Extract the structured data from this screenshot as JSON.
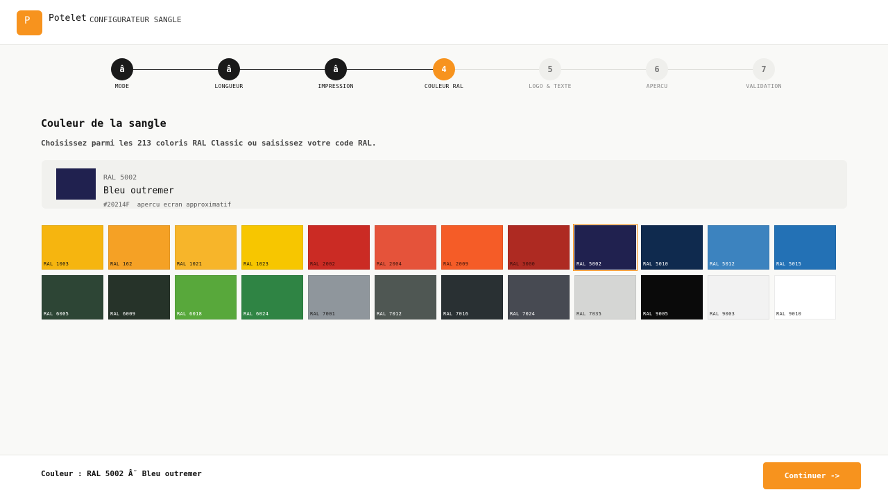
{
  "header": {
    "logo_letter": "P",
    "brand": "Potelet",
    "subtitle": "CONFIGURATEUR SANGLE"
  },
  "colors": {
    "accent": "#f7931e",
    "done": "#1a1a1a"
  },
  "stepper": {
    "steps": [
      {
        "marker": "â",
        "label": "MODE",
        "state": "done"
      },
      {
        "marker": "â",
        "label": "LONGUEUR",
        "state": "done"
      },
      {
        "marker": "â",
        "label": "IMPRESSION",
        "state": "done"
      },
      {
        "marker": "4",
        "label": "COULEUR RAL",
        "state": "active"
      },
      {
        "marker": "5",
        "label": "LOGO & TEXTE",
        "state": "todo"
      },
      {
        "marker": "6",
        "label": "APERCU",
        "state": "todo"
      },
      {
        "marker": "7",
        "label": "VALIDATION",
        "state": "todo"
      }
    ]
  },
  "main": {
    "title": "Couleur de la sangle",
    "subtitle": "Choisissez parmi les 213 coloris RAL Classic ou saisissez votre code RAL."
  },
  "preview": {
    "code": "RAL 5002",
    "name": "Bleu outremer",
    "hex": "#20214F",
    "note": "apercu ecran approximatif",
    "color": "#20214F"
  },
  "swatches": [
    {
      "label": "RAL 1003",
      "color": "#F6B50F",
      "text": "#111111"
    },
    {
      "label": "RAL 162",
      "color": "#F5A125",
      "text": "#111111"
    },
    {
      "label": "RAL 1021",
      "color": "#F7B52A",
      "text": "#111111"
    },
    {
      "label": "RAL 1023",
      "color": "#F7C600",
      "text": "#111111"
    },
    {
      "label": "RAL 2002",
      "color": "#CB2B24",
      "text": "#3a0c0a"
    },
    {
      "label": "RAL 2004",
      "color": "#E5533A",
      "text": "#3a120a"
    },
    {
      "label": "RAL 2009",
      "color": "#F55C27",
      "text": "#3a120a"
    },
    {
      "label": "RAL 3000",
      "color": "#AE2A22",
      "text": "#3a0c0a"
    },
    {
      "label": "RAL 5002",
      "color": "#20214F",
      "text": "#ffffff",
      "selected": true
    },
    {
      "label": "RAL 5010",
      "color": "#0F2A4E",
      "text": "#ffffff"
    },
    {
      "label": "RAL 5012",
      "color": "#3C83BF",
      "text": "#ffffff"
    },
    {
      "label": "RAL 5015",
      "color": "#2371B5",
      "text": "#ffffff"
    },
    {
      "label": "RAL 6005",
      "color": "#2D4535",
      "text": "#ffffff"
    },
    {
      "label": "RAL 6009",
      "color": "#263329",
      "text": "#ffffff"
    },
    {
      "label": "RAL 6018",
      "color": "#58A83B",
      "text": "#ffffff"
    },
    {
      "label": "RAL 6024",
      "color": "#2F8444",
      "text": "#ffffff"
    },
    {
      "label": "RAL 7001",
      "color": "#8F969C",
      "text": "#222222"
    },
    {
      "label": "RAL 7012",
      "color": "#4F5753",
      "text": "#ffffff"
    },
    {
      "label": "RAL 7016",
      "color": "#293033",
      "text": "#ffffff"
    },
    {
      "label": "RAL 7024",
      "color": "#474A52",
      "text": "#ffffff"
    },
    {
      "label": "RAL 7035",
      "color": "#D5D6D4",
      "text": "#333333"
    },
    {
      "label": "RAL 9005",
      "color": "#0A0A0A",
      "text": "#ffffff"
    },
    {
      "label": "RAL 9003",
      "color": "#F2F2F2",
      "text": "#333333"
    },
    {
      "label": "RAL 9010",
      "color": "#FFFFFF",
      "text": "#333333"
    }
  ],
  "footer": {
    "summary": "Couleur : RAL 5002 Â˘ Bleu outremer",
    "continue_label": "Continuer ->"
  }
}
